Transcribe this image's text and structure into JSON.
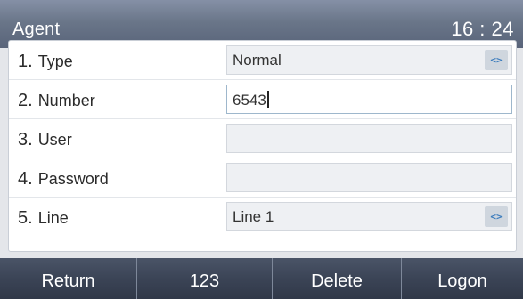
{
  "header": {
    "title": "Agent",
    "clock": "16 : 24"
  },
  "form": {
    "rows": [
      {
        "num": "1.",
        "label": "Type",
        "value": "Normal",
        "has_switch": true,
        "switch_icon": "<>"
      },
      {
        "num": "2.",
        "label": "Number",
        "value": "6543",
        "has_switch": false,
        "active": true
      },
      {
        "num": "3.",
        "label": "User",
        "value": ""
      },
      {
        "num": "4.",
        "label": "Password",
        "value": ""
      },
      {
        "num": "5.",
        "label": "Line",
        "value": "Line 1",
        "has_switch": true,
        "switch_icon": "<>"
      }
    ]
  },
  "softkeys": [
    "Return",
    "123",
    "Delete",
    "Logon"
  ]
}
